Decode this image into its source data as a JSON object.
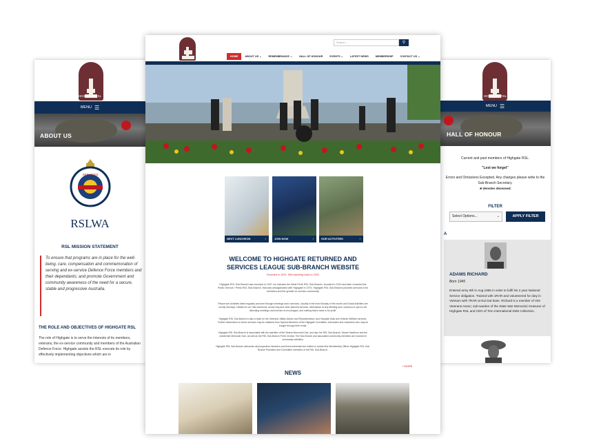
{
  "left": {
    "brand_caption": "HIGHGATE RSL",
    "menu_label": "MENU",
    "menu_icon": "hamburger-icon",
    "hero_title": "ABOUT US",
    "rsl_badge_text": "RETURNED AND SERVICES LEAGUE AUSTRALIA",
    "rsl_brand": "RSLWA",
    "mission_heading": "RSL MISSION STATEMENT",
    "mission_text": "To ensure that programs are in place for the well-being, care, compensation and commemoration of serving and ex-service Defence Force members and their dependants; and promote Government and community awareness of the need for a secure, stable and progressive Australia.",
    "role_heading": "THE ROLE AND OBJECTIVES OF HIGHGATE RSL",
    "role_text": "The role of Highgate is to serve the interests of its members, veterans, the ex-service community and members of the Australian Defence Force. Highgate assists the RSL execute its role by effectively implementing objectives which are in"
  },
  "desktop": {
    "search_placeholder": "Search ...",
    "search_icon": "search-icon",
    "menu": [
      "HOME",
      "ABOUT US ⌄",
      "REMEMBRANCE ⌄",
      "HALL OF HONOUR",
      "EVENTS ⌄",
      "LATEST NEWS",
      "MEMBERSHIP",
      "CONTACT US ⌄"
    ],
    "tiles": [
      {
        "label": "NEXT LUNCHEON",
        "arrow": "›"
      },
      {
        "label": "JOIN NOW",
        "arrow": "›"
      },
      {
        "label": "OUR ACTIVITIES",
        "arrow": "›"
      }
    ],
    "welcome_title": "WELCOME TO HIGHGATE RETURNED AND SERVICES LEAGUE SUB-BRANCH WEBSITE",
    "welcome_sub": "Founded in 1919. Still marching back to 2022",
    "para1": "Highgate RSL Sub-Branch was founded in 1947 our includes the West Perth RSL Sub-Branch, founded in 1919 and later renamed the Public Service / Press RSL Sub-Branch, that was amalgamated with Highgate in 1974. Highgate RSL Sub-Branch provides services to its members and the greater ex-service community.",
    "para2": "Please see Activities listed regularly and sent through meetings and e-services. Usually in the front Monday of the month and Social Activities are mostly Sundays. Details for our Hall luncheons, Anzac Day and other planned services. Attendance at any Meeting and Luncheon is open to all. Attending meetings and lunches is encouraged, and nothing that is done is for profit.",
    "para3": "Highgate RSL Sub-Branch is also a base for the Veterans' Affairs Advice and Representation, and Hospital Visits and Veteran Welfare services. Further information on these services may be obtained from Special Members of the Highgate Committee, Advocates and volunteers who may be sought through their email.",
    "para4": "Highgate RSL Sub-Branch is associated with the activities of the Sisters Memorial Club, and also the RSL Sub-Branch, Mount Hawthorn and the Leederville Memorial Club, as well as the RSL Sub-Branch Perth Central. The Sub-Branch and associated community members are involved in community activities.",
    "para5": "Highgate RSL Sub-Branch welcomes all prospective members and those interested are invited to contact the Membership Officer Highgate RSL Sub-Branch President and Committee members of the RSL Sub-Branch.",
    "more_link": "+ MORE",
    "news_title": "NEWS"
  },
  "right": {
    "brand_caption": "HIGHGATE RSL",
    "menu_label": "MENU",
    "hero_title": "HALL OF HONOUR",
    "intro": "Current and past members of Highgate RSL.",
    "quote": "\"Lest we forget\"",
    "errors": "Errors and Omissions Excepted. Any changes please write to the Sub-Branch Secretary.",
    "deceased": "★ denotes deceased.",
    "filter_heading": "FILTER",
    "select_value": "Select Options...",
    "apply_label": "APPLY FILTER",
    "letter": "A",
    "person_name": "ADAMS RICHARD",
    "person_born": "Born 1945",
    "person_bio": "Entered army 8th in Aug 1965 in order to fulfil his 2 year National Service obligation. Trained with 1RAR and volunteered for duty in Vietnam with 7RAR at Nui Dat base. Richard is a member of Viet Veterans Assoc; sub-warden of the State War Memorial; treasurer of Highgate RSL and CEO of Tinn International Debt Collection."
  },
  "colors": {
    "navy": "#0f2e55",
    "maroon": "#6d2f34",
    "red": "#d12c2c"
  }
}
